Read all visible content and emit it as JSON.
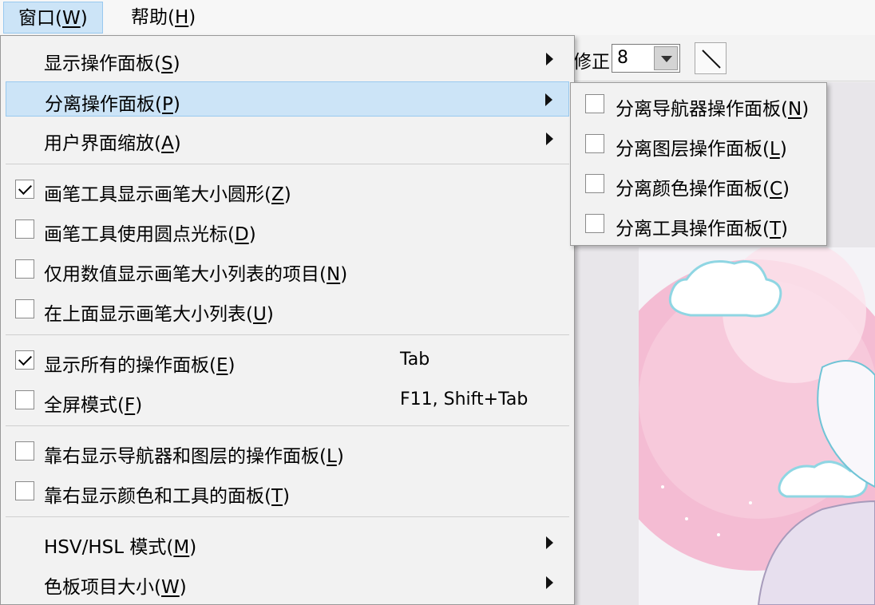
{
  "menubar": {
    "items": [
      {
        "label": "窗口(",
        "key": "W",
        "close": ")"
      },
      {
        "label": "帮助(",
        "key": "H",
        "close": ")"
      }
    ]
  },
  "toolbar": {
    "label": "修正",
    "value": "8"
  },
  "menu": {
    "items": [
      {
        "label": "显示操作面板(",
        "key": "S",
        "close": ")",
        "submenu": true
      },
      {
        "label": "分离操作面板(",
        "key": "P",
        "close": ")",
        "submenu": true,
        "highlighted": true
      },
      {
        "label": "用户界面缩放(",
        "key": "A",
        "close": ")",
        "submenu": true
      },
      {
        "label": "画笔工具显示画笔大小圆形(",
        "key": "Z",
        "close": ")",
        "checked": true
      },
      {
        "label": "画笔工具使用圆点光标(",
        "key": "D",
        "close": ")",
        "checked": false
      },
      {
        "label": "仅用数值显示画笔大小列表的项目(",
        "key": "N",
        "close": ")",
        "checked": false
      },
      {
        "label": "在上面显示画笔大小列表(",
        "key": "U",
        "close": ")",
        "checked": false
      },
      {
        "label": "显示所有的操作面板(",
        "key": "E",
        "close": ")",
        "checked": true,
        "shortcut": "Tab"
      },
      {
        "label": "全屏模式(",
        "key": "F",
        "close": ")",
        "checked": false,
        "shortcut": "F11, Shift+Tab"
      },
      {
        "label": "靠右显示导航器和图层的操作面板(",
        "key": "L",
        "close": ")",
        "checked": false
      },
      {
        "label": "靠右显示颜色和工具的面板(",
        "key": "T",
        "close": ")",
        "checked": false
      },
      {
        "label": "HSV/HSL 模式(",
        "key": "M",
        "close": ")",
        "submenu": true
      },
      {
        "label": "色板项目大小(",
        "key": "W",
        "close": ")",
        "submenu": true
      }
    ]
  },
  "submenu": {
    "items": [
      {
        "label": "分离导航器操作面板(",
        "key": "N",
        "close": ")",
        "checked": false
      },
      {
        "label": "分离图层操作面板(",
        "key": "L",
        "close": ")",
        "checked": false
      },
      {
        "label": "分离颜色操作面板(",
        "key": "C",
        "close": ")",
        "checked": false
      },
      {
        "label": "分离工具操作面板(",
        "key": "T",
        "close": ")",
        "checked": false
      }
    ]
  }
}
